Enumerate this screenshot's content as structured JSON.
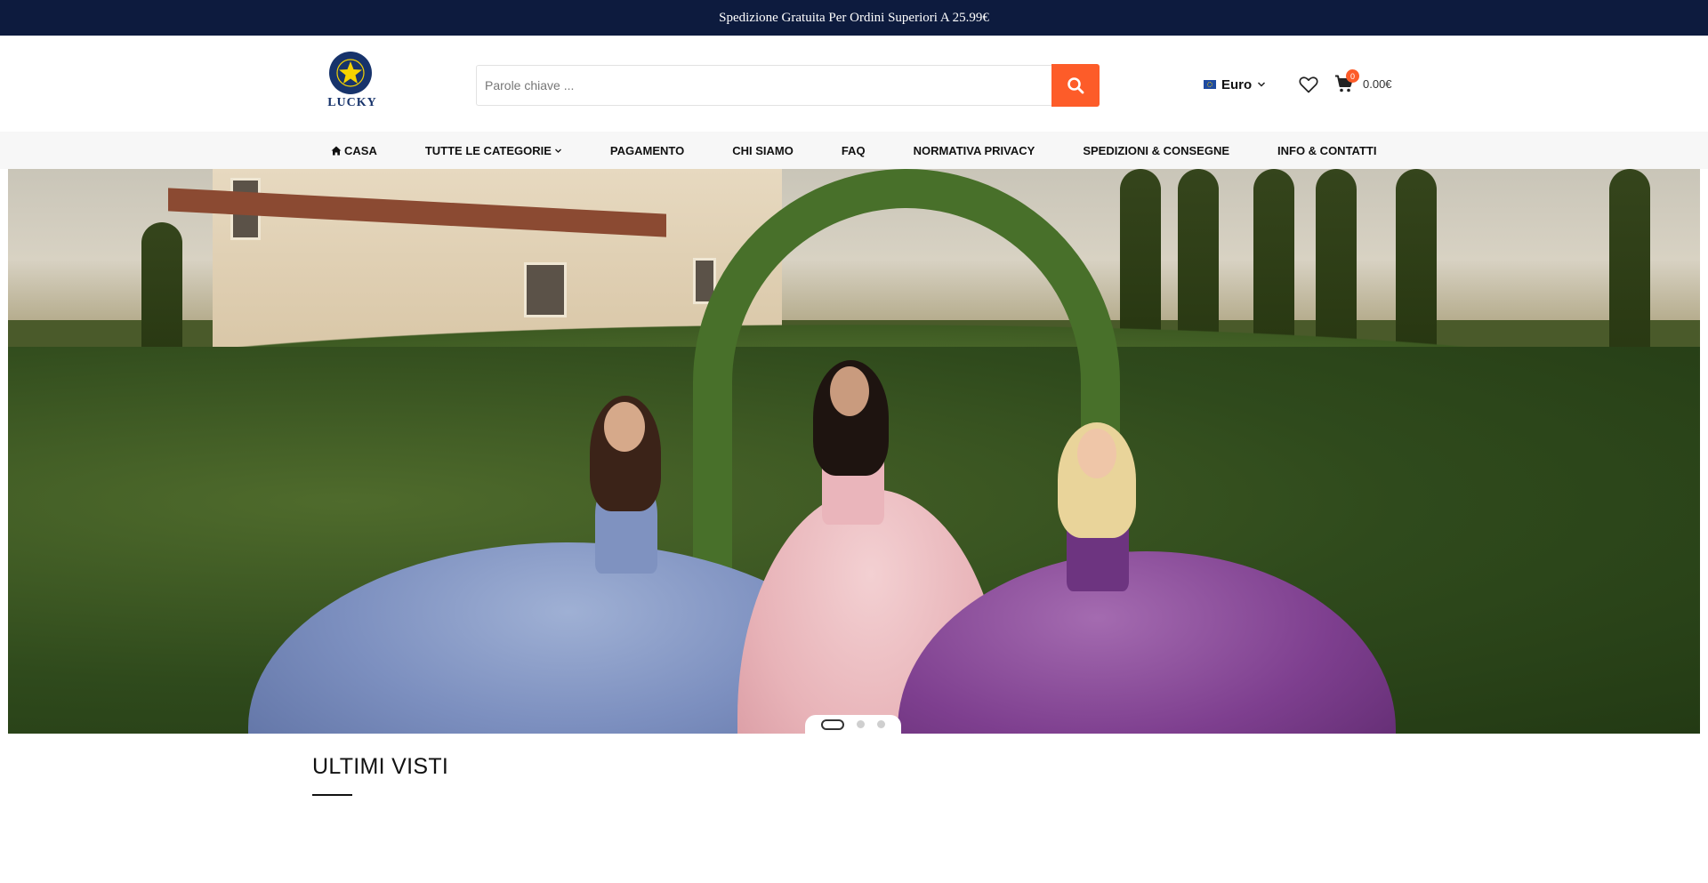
{
  "announcement": {
    "text": "Spedizione Gratuita Per Ordini Superiori A 25.99€"
  },
  "brand": {
    "name": "LUCKY",
    "color": "#17336b",
    "star_color": "#f5d200"
  },
  "search": {
    "placeholder": "Parole chiave ...",
    "value": "",
    "button_icon": "search-icon",
    "accent": "#fd5c29"
  },
  "currency": {
    "flag_icon": "eu-flag-icon",
    "label": "Euro"
  },
  "wishlist": {
    "icon": "heart-icon"
  },
  "cart": {
    "icon": "cart-icon",
    "count": "0",
    "total": "0.00€"
  },
  "nav": {
    "items": [
      {
        "label": "CASA",
        "icon": "home-icon"
      },
      {
        "label": "TUTTE LE CATEGORIE",
        "icon": "chevron-down-icon"
      },
      {
        "label": "PAGAMENTO"
      },
      {
        "label": "CHI SIAMO"
      },
      {
        "label": "FAQ"
      },
      {
        "label": "NORMATIVA PRIVACY"
      },
      {
        "label": "SPEDIZIONI & CONSEGNE"
      },
      {
        "label": "INFO & CONTATTI"
      }
    ]
  },
  "hero": {
    "image_subject": "three women in ball gowns (blue, pink, purple) wearing tiaras in a garden",
    "slides_total": 3,
    "active_slide": 1
  },
  "sections": {
    "recently_viewed_title": "ULTIMI VISTI"
  },
  "colors": {
    "topbar": "#0d1b3e",
    "nav_bg": "#f7f7f7"
  }
}
